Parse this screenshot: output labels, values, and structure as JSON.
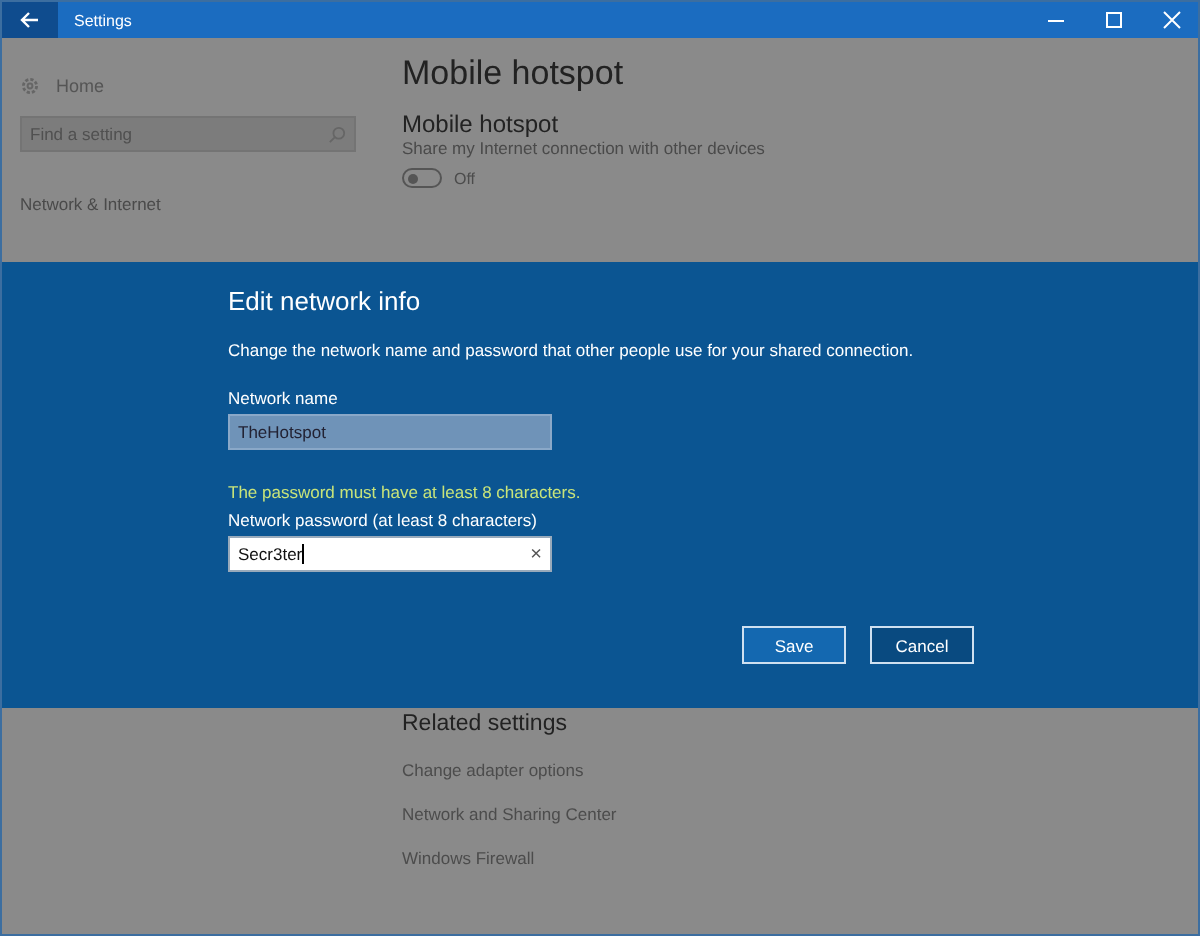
{
  "window": {
    "title": "Settings"
  },
  "sidebar": {
    "home": "Home",
    "search": {
      "placeholder": "Find a setting"
    },
    "section": "Network & Internet"
  },
  "page": {
    "title": "Mobile hotspot",
    "heading": "Mobile hotspot",
    "description": "Share my Internet connection with other devices",
    "toggle": {
      "on": false,
      "label": "Off"
    }
  },
  "dialog": {
    "title": "Edit network info",
    "description": "Change the network name and password that other people use for your shared connection.",
    "name_field": {
      "label": "Network name",
      "value": "TheHotspot"
    },
    "error": "The password must have at least 8 characters.",
    "password_field": {
      "label": "Network password (at least 8 characters)",
      "value": "Secr3ter",
      "clear": "×"
    },
    "buttons": [
      {
        "label": "Save",
        "kind": "primary"
      },
      {
        "label": "Cancel",
        "kind": "secondary"
      }
    ]
  },
  "related": {
    "heading": "Related settings",
    "links": [
      "Change adapter options",
      "Network and Sharing Center",
      "Windows Firewall"
    ]
  }
}
